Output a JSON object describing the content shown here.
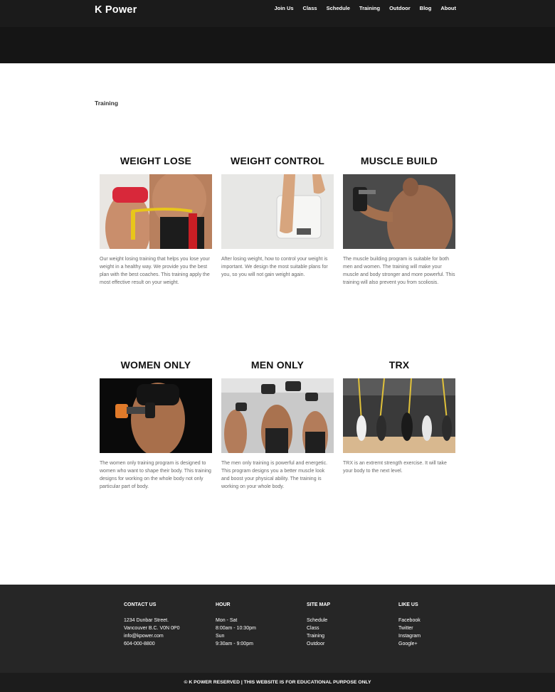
{
  "brand": {
    "logo": "K Power"
  },
  "nav": [
    "Join Us",
    "Class",
    "Schedule",
    "Training",
    "Outdoor",
    "Blog",
    "About"
  ],
  "page": {
    "title": "Training"
  },
  "programs": [
    {
      "title": "WEIGHT LOSE",
      "image": "weight-lose-photo",
      "desc": "Our weight losing training that helps you lose your weight in a healthy way. We provide you the best plan with the best coaches. This training apply the most effective result on your weight."
    },
    {
      "title": "WEIGHT CONTROL",
      "image": "weight-control-photo",
      "desc": "After losing weight, how to control your weight is important. We design the most suitable plans for you, so you will not gain weight again."
    },
    {
      "title": "MUSCLE BUILD",
      "image": "muscle-build-photo",
      "desc": "The muscle building program is suitable for both men and women. The training will make your muscle and body stronger and more powerful. This training will also prevent you from scoliosis."
    },
    {
      "title": "WOMEN ONLY",
      "image": "women-only-photo",
      "desc": "The women only training program is designed to women who want to shape their body. This training designs for working on the whole body not only particular part of body."
    },
    {
      "title": "MEN ONLY",
      "image": "men-only-photo",
      "desc": "The men only training is powerful and energetic. This program designs you a better muscle look and boost your physical ability. The training is working on your whole body."
    },
    {
      "title": "TRX",
      "image": "trx-photo",
      "desc": "TRX is an extremt strength exercise. It will take your body to the next level."
    }
  ],
  "footer": {
    "contact": {
      "heading": "CONTACT US",
      "lines": [
        "1234 Dunbar Street.",
        "Vancouver B.C. V0N 0P0",
        "info@kpower.com",
        "604-000-8800"
      ]
    },
    "hour": {
      "heading": "HOUR",
      "lines": [
        "Mon - Sat",
        "8:00am - 10:30pm",
        "Sun",
        "9:30am - 9:00pm"
      ]
    },
    "sitemap": {
      "heading": "SITE MAP",
      "links": [
        "Schedule",
        "Class",
        "Training",
        "Outdoor"
      ]
    },
    "like": {
      "heading": "LIKE US",
      "links": [
        "Facebook",
        "Twitter",
        "Instagram",
        "Google+"
      ]
    },
    "copyright": "© K POWER RESERVED | THIS WEBSITE IS FOR EDUCATIONAL PURPOSE ONLY"
  },
  "colors": {
    "header": "#151515",
    "footer": "#262626",
    "bottom_bar": "#1c1c1c"
  }
}
